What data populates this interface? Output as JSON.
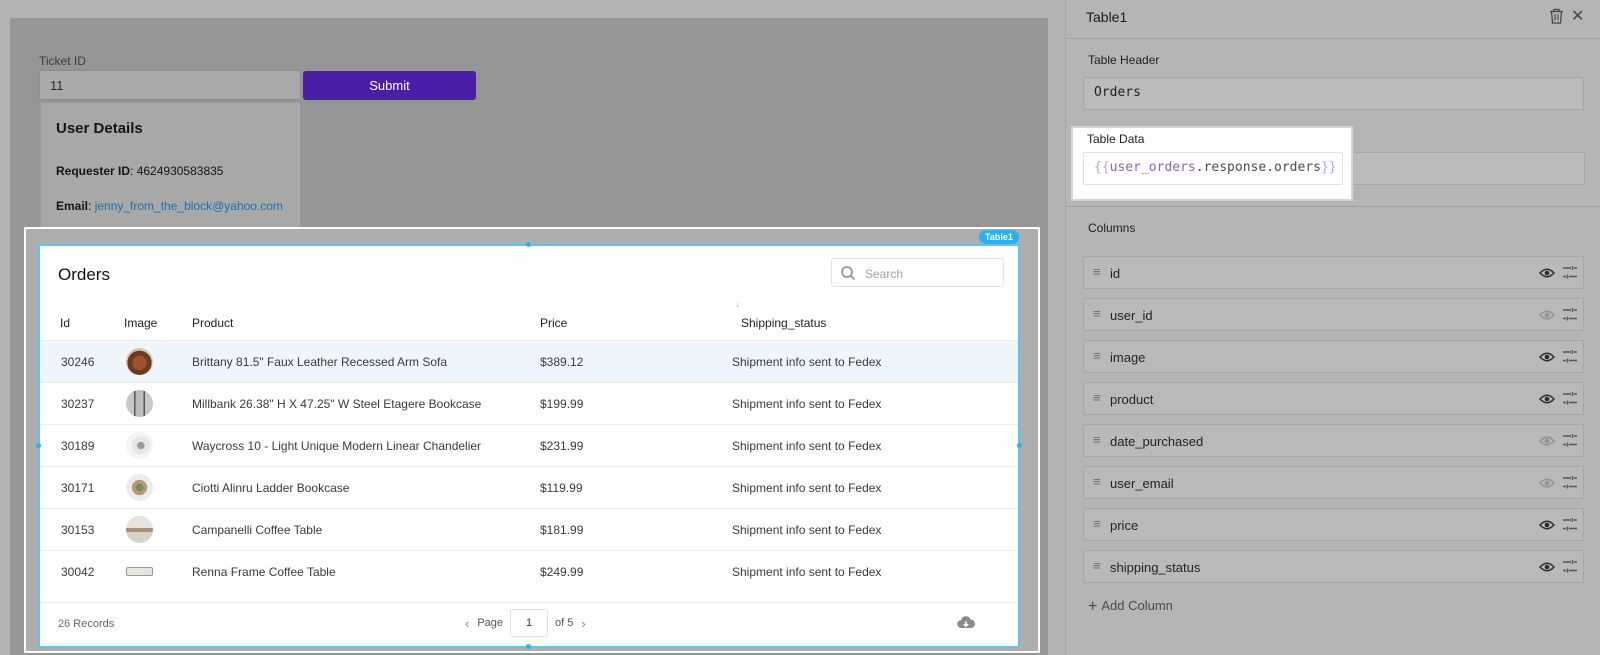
{
  "form": {
    "ticket_label": "Ticket ID",
    "ticket_value": "11",
    "submit_label": "Submit"
  },
  "user_details": {
    "title": "User Details",
    "requester_label": "Requester ID",
    "requester_value": "4624930583835",
    "email_label": "Email",
    "email_value": "jenny_from_the_block@yahoo.com"
  },
  "table_widget": {
    "tag": "Table1",
    "title": "Orders",
    "search_placeholder": "Search",
    "columns": [
      "Id",
      "Image",
      "Product",
      "Price",
      "Shipping_status"
    ],
    "rows": [
      {
        "id": "30246",
        "image": "sofa-thumbnail",
        "product": "Brittany 81.5\" Faux Leather Recessed Arm Sofa",
        "price": "$389.12",
        "status": "Shipment info sent to Fedex"
      },
      {
        "id": "30237",
        "image": "bookcase-thumbnail",
        "product": "Millbank 26.38\" H X 47.25\" W Steel Etagere Bookcase",
        "price": "$199.99",
        "status": "Shipment info sent to Fedex"
      },
      {
        "id": "30189",
        "image": "chandelier-thumbnail",
        "product": "Waycross 10 - Light Unique Modern Linear Chandelier",
        "price": "$231.99",
        "status": "Shipment info sent to Fedex"
      },
      {
        "id": "30171",
        "image": "ladder-bookcase-thumbnail",
        "product": "Ciotti Alinru Ladder Bookcase",
        "price": "$119.99",
        "status": "Shipment info sent to Fedex"
      },
      {
        "id": "30153",
        "image": "coffee-table-thumbnail",
        "product": "Campanelli Coffee Table",
        "price": "$181.99",
        "status": "Shipment info sent to Fedex"
      },
      {
        "id": "30042",
        "image": "frame-table-thumbnail",
        "product": "Renna Frame Coffee Table",
        "price": "$249.99",
        "status": "Shipment info sent to Fedex"
      }
    ],
    "records": "26 Records",
    "page_label": "Page",
    "page_value": "1",
    "page_total": "of 5"
  },
  "pane": {
    "title": "Table1",
    "table_header_label": "Table Header",
    "table_header_value": "Orders",
    "table_data_label": "Table Data",
    "table_data_open": "{{",
    "table_data_var": "user_orders",
    "table_data_path": ".response.orders",
    "table_data_close": "}}",
    "columns_label": "Columns",
    "columns": [
      {
        "name": "id",
        "visible": true
      },
      {
        "name": "user_id",
        "visible": false
      },
      {
        "name": "image",
        "visible": true
      },
      {
        "name": "product",
        "visible": true
      },
      {
        "name": "date_purchased",
        "visible": false
      },
      {
        "name": "user_email",
        "visible": false
      },
      {
        "name": "price",
        "visible": true
      },
      {
        "name": "shipping_status",
        "visible": true
      }
    ],
    "add_column_label": "Add Column"
  },
  "colors": {
    "accent": "#4a1ea6",
    "selection": "#5cc3f0",
    "link": "#1e6fae"
  }
}
